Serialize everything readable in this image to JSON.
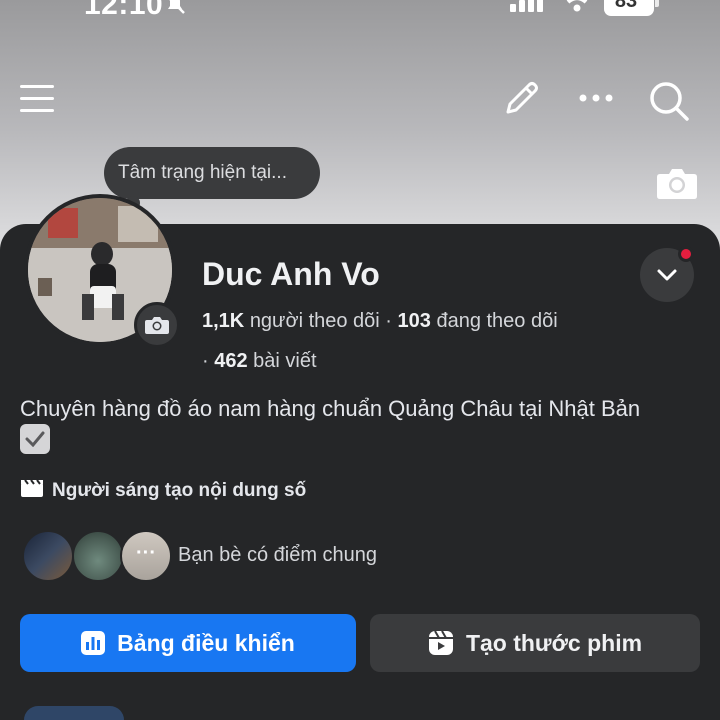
{
  "status_bar": {
    "time": "12:10",
    "battery": "83"
  },
  "header": {
    "icons": [
      "menu-icon",
      "edit-icon",
      "more-icon",
      "search-icon",
      "camera-icon"
    ]
  },
  "mood": {
    "placeholder": "Tâm trạng hiện tại..."
  },
  "profile": {
    "name": "Duc Anh Vo",
    "followers_count": "1,1K",
    "followers_label": "người theo dõi",
    "following_count": "103",
    "following_label": "đang theo dõi",
    "posts_count": "462",
    "posts_label": "bài viết",
    "bio": "Chuyên hàng đồ áo nam hàng chuẩn Quảng Châu tại Nhật Bản",
    "creator_label": "Người sáng tạo nội dung số",
    "mutual_friends_label": "Bạn bè có điểm chung"
  },
  "actions": {
    "dashboard_label": "Bảng điều khiển",
    "create_reel_label": "Tạo thước phim"
  },
  "colors": {
    "primary": "#1877f2",
    "panel": "#252628",
    "secondary_button": "#3a3b3d",
    "badge": "#e41e3f"
  }
}
